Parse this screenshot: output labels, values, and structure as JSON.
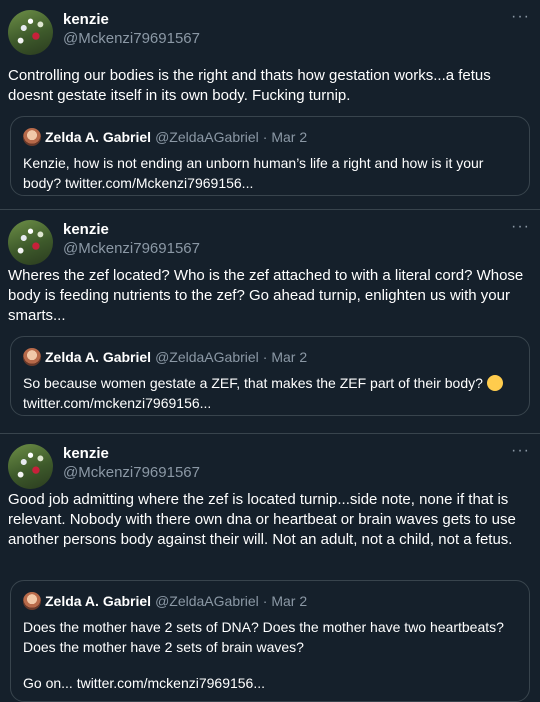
{
  "tweets": [
    {
      "name": "kenzie",
      "handle": "@Mckenzi79691567",
      "text": "Controlling our bodies is the right and thats how gestation works...a fetus doesnt gestate itself in its own body. Fucking turnip.",
      "quote": {
        "name": "Zelda A. Gabriel",
        "handle": "@ZeldaAGabriel",
        "date_line": "· Mar 2",
        "text": "Kenzie, how is not ending an unborn human’s life a right and how is it your body? twitter.com/Mckenzi7969156..."
      }
    },
    {
      "name": "kenzie",
      "handle": "@Mckenzi79691567",
      "text": "Wheres the zef located? Who is the zef attached to with a literal cord? Whose body is feeding nutrients to the zef? Go ahead turnip, enlighten us with your smarts...",
      "quote": {
        "name": "Zelda A. Gabriel",
        "handle": "@ZeldaAGabriel",
        "date_line": "· Mar 2",
        "text": "So because women gestate a ZEF, that makes the ZEF part of their body?",
        "link": "twitter.com/mckenzi7969156..."
      }
    },
    {
      "name": "kenzie",
      "handle": "@Mckenzi79691567",
      "text": "Good job admitting where the zef is located turnip...side note, none if that is relevant. Nobody with there own dna or heartbeat or brain waves gets to use another persons body against their will. Not an adult, not a child, not a fetus.",
      "quote": {
        "name": "Zelda A. Gabriel",
        "handle": "@ZeldaAGabriel",
        "date_line": "· Mar 2",
        "text": "Does the mother have 2 sets of DNA? Does the mother have two heartbeats? Does the mother have 2 sets of brain waves?",
        "text2": "Go on... twitter.com/mckenzi7969156..."
      }
    }
  ],
  "more_glyph": "···",
  "icons": {
    "avatar": "profile-photo",
    "more": "more-icon",
    "emoji": "thinking-face-icon"
  }
}
